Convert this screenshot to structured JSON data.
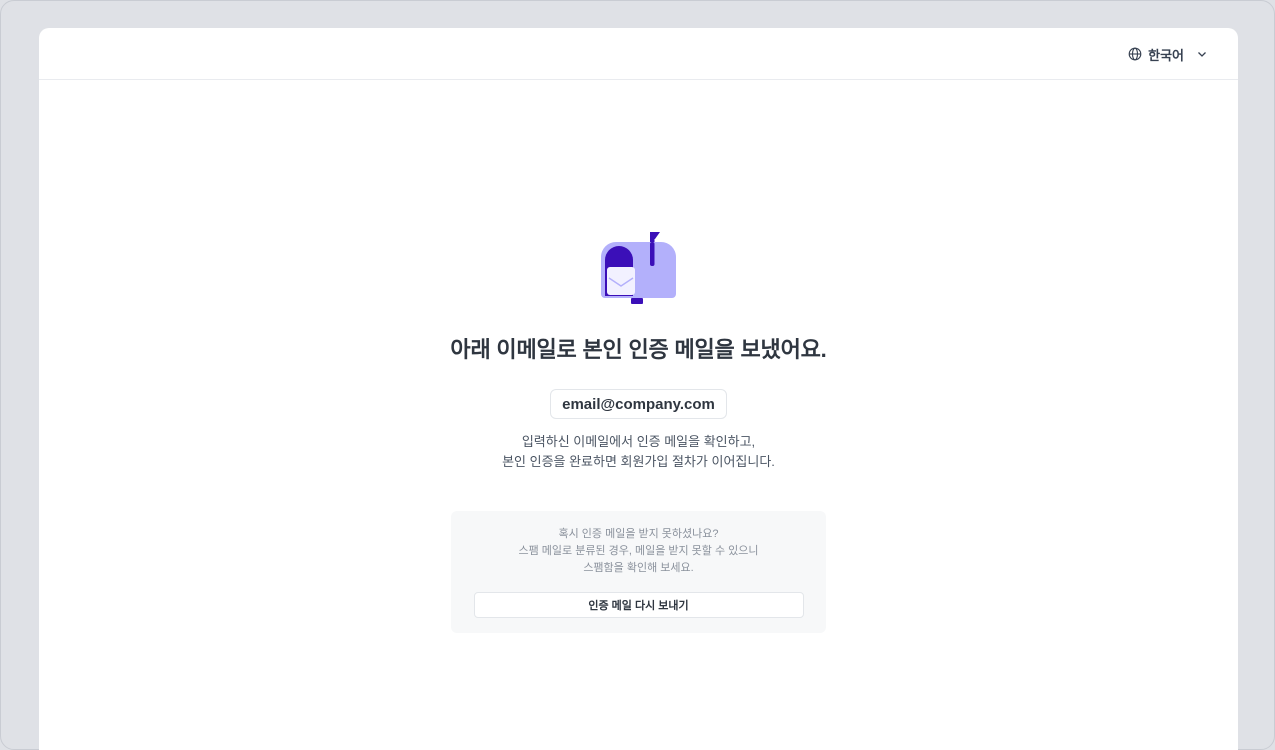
{
  "header": {
    "language": {
      "label": "한국어",
      "icon": "globe-icon",
      "chevron": "chevron-down-icon"
    }
  },
  "main": {
    "illustration": "mailbox-icon",
    "title": "아래 이메일로 본인 인증 메일을 보냈어요.",
    "email": "email@company.com",
    "description_line1": "입력하신 이메일에서 인증 메일을 확인하고,",
    "description_line2": "본인 인증을 완료하면 회원가입 절차가 이어집니다."
  },
  "help": {
    "line1": "혹시 인증 메일을 받지 못하셨나요?",
    "line2": "스팸 메일로 분류된 경우, 메일을 받지 못할 수 있으니",
    "line3": "스팸함을 확인해 보세요.",
    "resend_label": "인증 메일 다시 보내기"
  },
  "colors": {
    "accent": "#3b0fb8",
    "mailbox_light": "#b3b0fb",
    "background": "#dfe1e6"
  }
}
